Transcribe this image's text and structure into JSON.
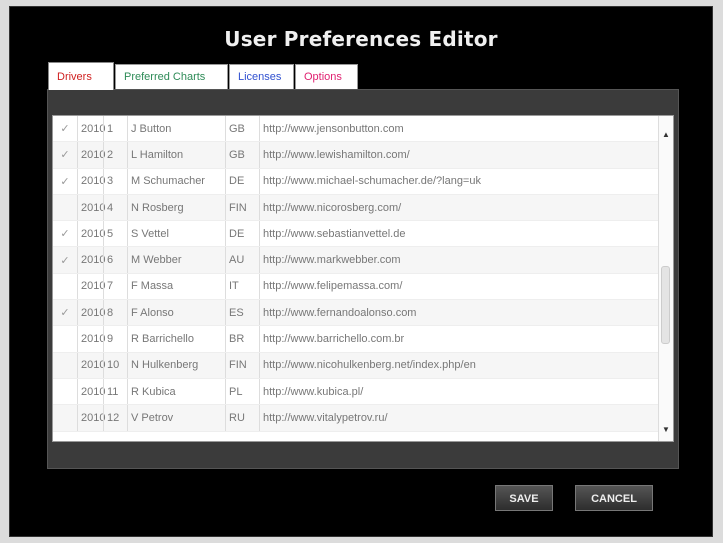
{
  "window": {
    "title": "User Preferences Editor"
  },
  "tabs": [
    {
      "label": "Drivers",
      "color": "#d02020",
      "active": true
    },
    {
      "label": "Preferred Charts",
      "color": "#2e8b57",
      "active": false
    },
    {
      "label": "Licenses",
      "color": "#3050d0",
      "active": false
    },
    {
      "label": "Options",
      "color": "#e02070",
      "active": false
    }
  ],
  "drivers": [
    {
      "checked": true,
      "year": "2010",
      "num": "1",
      "name": "J Button",
      "nat": "GB",
      "url": "http://www.jensonbutton.com"
    },
    {
      "checked": true,
      "year": "2010",
      "num": "2",
      "name": "L Hamilton",
      "nat": "GB",
      "url": "http://www.lewishamilton.com/"
    },
    {
      "checked": true,
      "year": "2010",
      "num": "3",
      "name": "M Schumacher",
      "nat": "DE",
      "url": "http://www.michael-schumacher.de/?lang=uk"
    },
    {
      "checked": false,
      "year": "2010",
      "num": "4",
      "name": "N Rosberg",
      "nat": "FIN",
      "url": "http://www.nicorosberg.com/"
    },
    {
      "checked": true,
      "year": "2010",
      "num": "5",
      "name": "S Vettel",
      "nat": "DE",
      "url": "http://www.sebastianvettel.de"
    },
    {
      "checked": true,
      "year": "2010",
      "num": "6",
      "name": "M Webber",
      "nat": "AU",
      "url": "http://www.markwebber.com"
    },
    {
      "checked": false,
      "year": "2010",
      "num": "7",
      "name": "F Massa",
      "nat": "IT",
      "url": "http://www.felipemassa.com/"
    },
    {
      "checked": true,
      "year": "2010",
      "num": "8",
      "name": "F Alonso",
      "nat": "ES",
      "url": "http://www.fernandoalonso.com"
    },
    {
      "checked": false,
      "year": "2010",
      "num": "9",
      "name": "R Barrichello",
      "nat": "BR",
      "url": "http://www.barrichello.com.br"
    },
    {
      "checked": false,
      "year": "2010",
      "num": "10",
      "name": "N Hulkenberg",
      "nat": "FIN",
      "url": "http://www.nicohulkenberg.net/index.php/en"
    },
    {
      "checked": false,
      "year": "2010",
      "num": "11",
      "name": "R Kubica",
      "nat": "PL",
      "url": "http://www.kubica.pl/"
    },
    {
      "checked": false,
      "year": "2010",
      "num": "12",
      "name": "V Petrov",
      "nat": "RU",
      "url": "http://www.vitalypetrov.ru/"
    }
  ],
  "buttons": {
    "save": "SAVE",
    "cancel": "CANCEL"
  },
  "icons": {
    "scroll_up": "▲",
    "scroll_down": "▼",
    "check": "✓"
  }
}
